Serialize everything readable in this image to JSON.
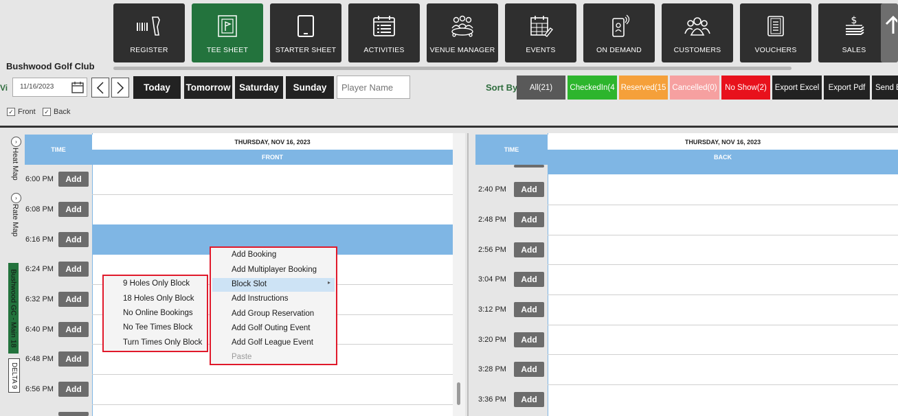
{
  "club": {
    "name": "Bushwood Golf Club"
  },
  "nav": {
    "items": [
      {
        "id": "register",
        "label": "REGISTER",
        "icon": "barcode-scanner-icon"
      },
      {
        "id": "tee-sheet",
        "label": "TEE SHEET",
        "icon": "flag-board-icon",
        "active": true
      },
      {
        "id": "starter-sheet",
        "label": "STARTER SHEET",
        "icon": "tablet-icon"
      },
      {
        "id": "activities",
        "label": "ACTIVITIES",
        "icon": "calendar-list-icon"
      },
      {
        "id": "venue-manager",
        "label": "VENUE MANAGER",
        "icon": "meeting-table-icon"
      },
      {
        "id": "events",
        "label": "EVENTS",
        "icon": "calendar-edit-icon"
      },
      {
        "id": "on-demand",
        "label": "ON DEMAND",
        "icon": "phone-signal-icon"
      },
      {
        "id": "customers",
        "label": "CUSTOMERS",
        "icon": "group-icon"
      },
      {
        "id": "vouchers",
        "label": "VOUCHERS",
        "icon": "document-icon"
      },
      {
        "id": "sales",
        "label": "SALES",
        "icon": "money-icon"
      }
    ]
  },
  "toolbar": {
    "view_label": "Vi",
    "date_value": "11/16/2023",
    "today": "Today",
    "tomorrow": "Tomorrow",
    "saturday": "Saturday",
    "sunday": "Sunday",
    "player_placeholder": "Player Name",
    "sort_by": "Sort By",
    "filters": {
      "all": "All(21)",
      "checked_in": "CheckedIn(4",
      "reserved": "Reserved(15",
      "cancelled": "Cancelled(0)",
      "no_show": "No Show(2)"
    },
    "export_excel": "Export Excel",
    "export_pdf": "Export Pdf",
    "send": "Send E",
    "front_label": "Front",
    "back_label": "Back"
  },
  "colors": {
    "all": "#595959",
    "checked_in": "#2db52d",
    "reserved": "#f5a03a",
    "cancelled": "#f6a0a0",
    "no_show": "#e8111c"
  },
  "side_tabs": {
    "heat_map": "Heat Map",
    "rate_map": "Rate Map",
    "course": "Bushwood GC - Main 18",
    "delta": "DELTA 9"
  },
  "front": {
    "time_header": "TIME",
    "date_header": "THURSDAY, NOV 16, 2023",
    "side_header": "FRONT",
    "add_label": "Add",
    "times": [
      "6:00 PM",
      "6:08 PM",
      "6:16 PM",
      "6:24 PM",
      "6:32 PM",
      "6:40 PM",
      "6:48 PM",
      "6:56 PM"
    ]
  },
  "back": {
    "time_header": "TIME",
    "date_header": "THURSDAY, NOV 16, 2023",
    "side_header": "BACK",
    "add_label": "Add",
    "times": [
      "2:40 PM",
      "2:48 PM",
      "2:56 PM",
      "3:04 PM",
      "3:12 PM",
      "3:20 PM",
      "3:28 PM",
      "3:36 PM"
    ]
  },
  "context_menu": {
    "items": [
      "Add Booking",
      "Add Multiplayer Booking",
      "Block Slot",
      "Add Instructions",
      "Add Group Reservation",
      "Add Golf Outing Event",
      "Add Golf League Event",
      "Paste"
    ]
  },
  "block_submenu": {
    "items": [
      "9 Holes Only Block",
      "18 Holes Only Block",
      "No Online Bookings",
      "No Tee Times Block",
      "Turn Times Only Block"
    ]
  }
}
